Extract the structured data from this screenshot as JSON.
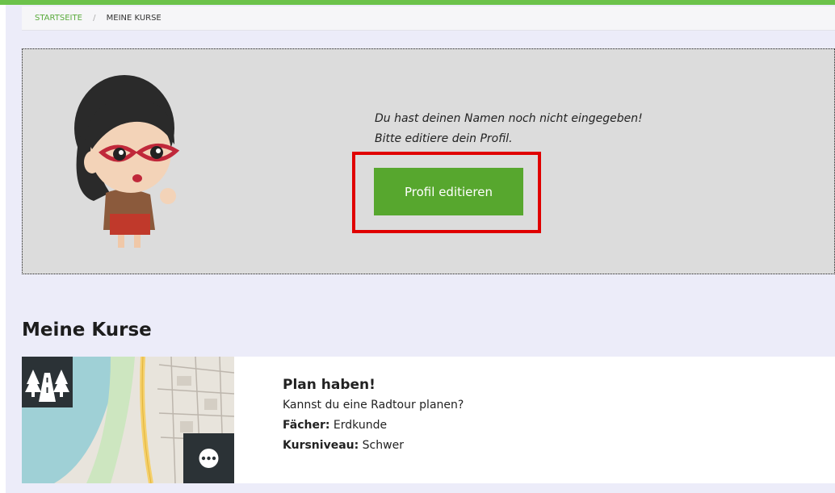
{
  "breadcrumb": {
    "home": "STARTSEITE",
    "separator": "/",
    "current": "MEINE KURSE"
  },
  "notice": {
    "line1": "Du hast deinen Namen noch nicht eingegeben!",
    "line2": "Bitte editiere dein Profil.",
    "button_label": "Profil editieren"
  },
  "section": {
    "title": "Meine Kurse"
  },
  "courses": [
    {
      "title": "Plan haben!",
      "description": "Kannst du eine Radtour planen?",
      "subjects_label": "Fächer:",
      "subjects_value": "Erdkunde",
      "level_label": "Kursniveau:",
      "level_value": "Schwer",
      "category_icon": "forest-road-icon",
      "more_icon": "more-dots-icon"
    }
  ],
  "colors": {
    "accent_green": "#57a72e",
    "highlight_red": "#e00000",
    "top_bar": "#6cc24a",
    "icon_bg": "#2b3236"
  }
}
